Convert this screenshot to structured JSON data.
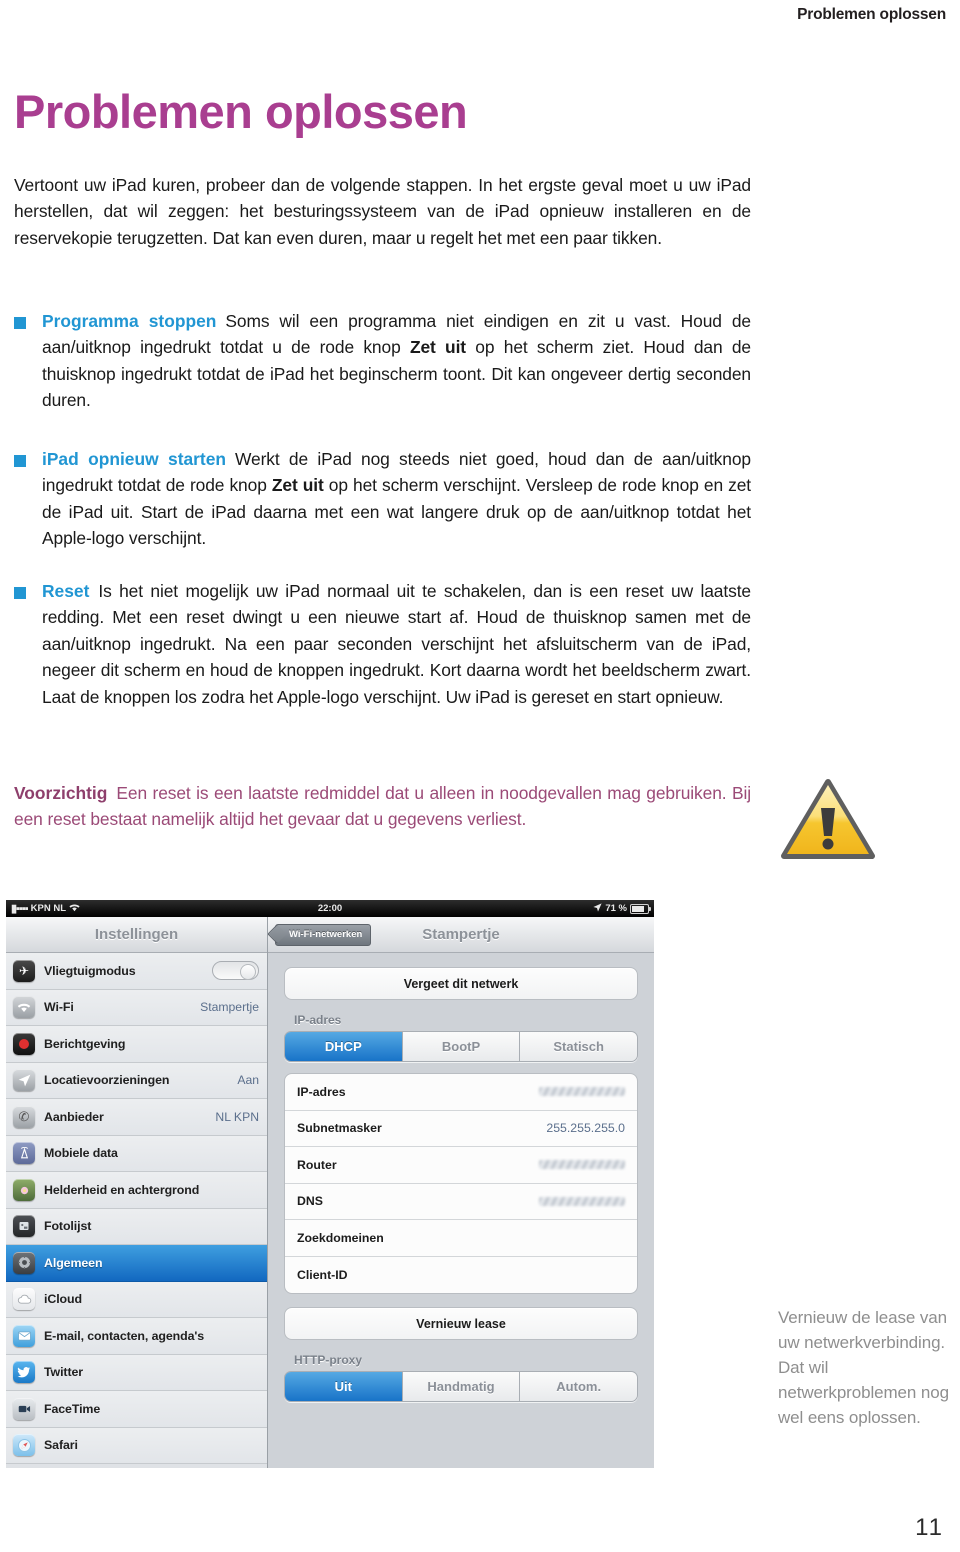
{
  "running_head": "Problemen oplossen",
  "page_title": "Problemen oplossen",
  "page_number": "11",
  "colors": {
    "title_magenta": "#a93e90",
    "bullet_blue": "#2196d3",
    "caution_purple": "#9b4a77",
    "body_black": "#1a1a1a",
    "ios_accent_blue": "#1873c8"
  },
  "body": {
    "lead": "Vertoont uw iPad kuren, probeer dan de volgende stappen. In het ergste geval moet u uw iPad herstellen, dat wil zeggen: het besturingssysteem van de iPad opnieuw installeren en de reservekopie terugzetten. Dat kan even duren, maar u regelt het met een paar tikken.",
    "items": [
      {
        "lead_in": "Programma stoppen",
        "text_1": "Soms wil een programma niet eindigen en zit u vast. Houd de aan/uitknop ingedrukt totdat u de rode knop ",
        "emphasis": "Zet uit",
        "text_2": " op het scherm ziet. Houd dan de thuisknop ingedrukt totdat de iPad het beginscherm toont. Dit kan ongeveer dertig seconden duren."
      },
      {
        "lead_in": "iPad opnieuw starten",
        "text_1": "Werkt de iPad nog steeds niet goed, houd dan de aan/uitknop ingedrukt totdat de rode knop ",
        "emphasis": "Zet uit",
        "text_2": " op het scherm verschijnt. Versleep de rode knop en zet de iPad uit. Start de iPad daarna met een wat langere druk op de aan/uitknop totdat het Apple-logo verschijnt."
      },
      {
        "lead_in": "Reset",
        "text_1": "Is het niet mogelijk uw iPad normaal uit te schakelen, dan is een reset uw laatste redding. Met een reset dwingt u een nieuwe start af. Houd de thuisknop samen met de aan/uitknop ingedrukt. Na een paar seconden verschijnt het afsluitscherm van de iPad, negeer dit scherm en houd de knoppen ingedrukt. Kort daarna wordt het beeldscherm zwart. Laat de knoppen los zodra het Apple-logo verschijnt. Uw iPad is gereset en start opnieuw.",
        "emphasis": "",
        "text_2": ""
      }
    ],
    "caution": {
      "lead_in": "Voorzichtig",
      "text": "Een reset is een laatste redmiddel dat u alleen in noodgevallen mag gebruiken. Bij een reset bestaat namelijk altijd het gevaar dat u gegevens verliest."
    }
  },
  "margin_note": "Vernieuw de lease van uw netwerkverbinding. Dat wil netwerkproblemen nog wel eens oplossen.",
  "screenshot": {
    "status_bar": {
      "carrier": "KPN NL",
      "time": "22:00",
      "battery_percent": "71 %"
    },
    "sidebar": {
      "title": "Instellingen",
      "items": [
        {
          "label": "Vliegtuigmodus",
          "value": "",
          "control": "toggle",
          "icon": "airplane-icon",
          "selected": false
        },
        {
          "label": "Wi-Fi",
          "value": "Stampertje",
          "control": "value",
          "icon": "wifi-icon",
          "selected": false
        },
        {
          "label": "Berichtgeving",
          "value": "",
          "control": "none",
          "icon": "notifications-icon",
          "selected": false
        },
        {
          "label": "Locatievoorzieningen",
          "value": "Aan",
          "control": "value",
          "icon": "location-icon",
          "selected": false
        },
        {
          "label": "Aanbieder",
          "value": "NL KPN",
          "control": "value",
          "icon": "phone-icon",
          "selected": false
        },
        {
          "label": "Mobiele data",
          "value": "",
          "control": "none",
          "icon": "cellular-icon",
          "selected": false
        },
        {
          "label": "Helderheid en achtergrond",
          "value": "",
          "control": "none",
          "icon": "brightness-icon",
          "selected": false
        },
        {
          "label": "Fotolijst",
          "value": "",
          "control": "none",
          "icon": "photoframe-icon",
          "selected": false
        },
        {
          "label": "Algemeen",
          "value": "",
          "control": "none",
          "icon": "gear-icon",
          "selected": true
        },
        {
          "label": "iCloud",
          "value": "",
          "control": "none",
          "icon": "cloud-icon",
          "selected": false
        },
        {
          "label": "E-mail, contacten, agenda's",
          "value": "",
          "control": "none",
          "icon": "mail-icon",
          "selected": false
        },
        {
          "label": "Twitter",
          "value": "",
          "control": "none",
          "icon": "twitter-icon",
          "selected": false
        },
        {
          "label": "FaceTime",
          "value": "",
          "control": "none",
          "icon": "facetime-icon",
          "selected": false
        },
        {
          "label": "Safari",
          "value": "",
          "control": "none",
          "icon": "safari-icon",
          "selected": false
        }
      ]
    },
    "detail": {
      "back_button": "Wi-Fi-netwerken",
      "title": "Stampertje",
      "forget_button": "Vergeet dit netwerk",
      "ip_group_label": "IP-adres",
      "ip_segments": [
        {
          "label": "DHCP",
          "selected": true
        },
        {
          "label": "BootP",
          "selected": false
        },
        {
          "label": "Statisch",
          "selected": false
        }
      ],
      "ip_rows": [
        {
          "key": "IP-adres",
          "value": "",
          "redacted": true
        },
        {
          "key": "Subnetmasker",
          "value": "255.255.255.0",
          "redacted": false
        },
        {
          "key": "Router",
          "value": "",
          "redacted": true
        },
        {
          "key": "DNS",
          "value": "",
          "redacted": true
        },
        {
          "key": "Zoekdomeinen",
          "value": "",
          "redacted": false
        },
        {
          "key": "Client-ID",
          "value": "",
          "redacted": false
        }
      ],
      "renew_button": "Vernieuw lease",
      "proxy_group_label": "HTTP-proxy",
      "proxy_segments": [
        {
          "label": "Uit",
          "selected": true
        },
        {
          "label": "Handmatig",
          "selected": false
        },
        {
          "label": "Autom.",
          "selected": false
        }
      ]
    }
  }
}
